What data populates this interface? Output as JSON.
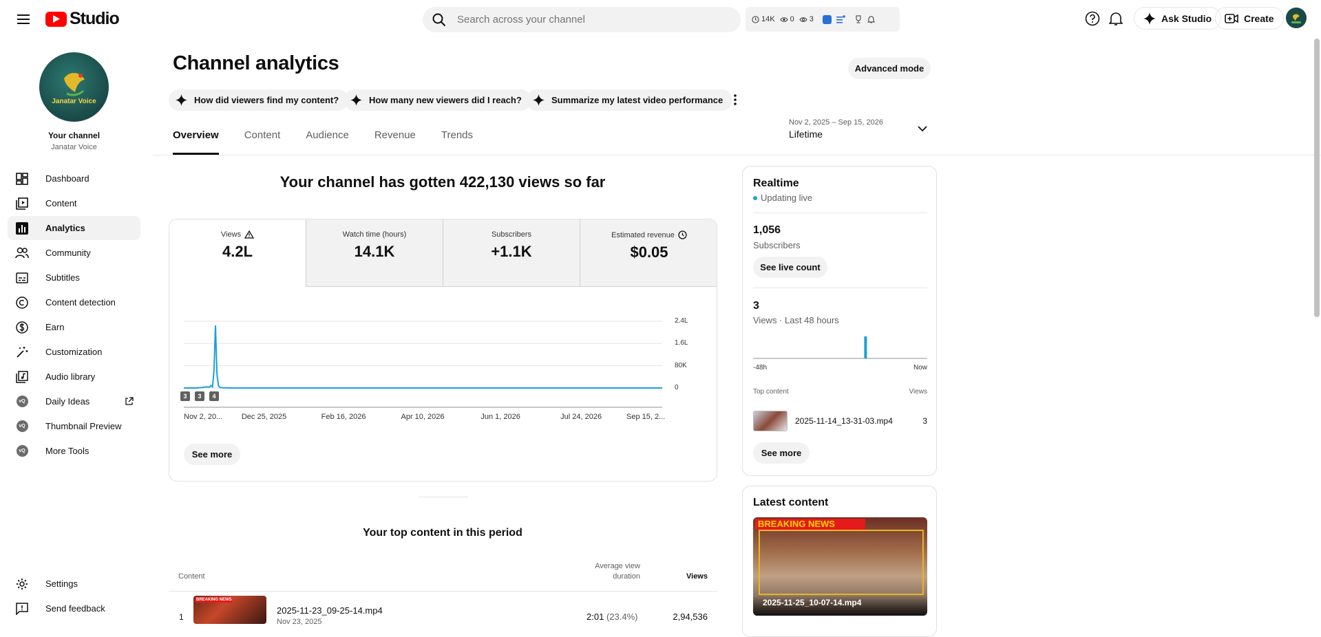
{
  "header": {
    "logo_text": "Studio",
    "search_placeholder": "Search across your channel",
    "stats": [
      {
        "icon": "clock-icon",
        "value": "14K"
      },
      {
        "icon": "eye-icon",
        "value": "0"
      },
      {
        "icon": "eye-outline-icon",
        "value": "3"
      }
    ],
    "ask_studio": "Ask Studio",
    "create": "Create"
  },
  "sidebar": {
    "channel_label": "Your channel",
    "channel_name": "Janatar Voice",
    "avatar_text": "Janatar Voice",
    "items": [
      {
        "label": "Dashboard",
        "icon": "dashboard-icon"
      },
      {
        "label": "Content",
        "icon": "content-icon"
      },
      {
        "label": "Analytics",
        "icon": "analytics-icon",
        "active": true
      },
      {
        "label": "Community",
        "icon": "community-icon"
      },
      {
        "label": "Subtitles",
        "icon": "subtitles-icon"
      },
      {
        "label": "Content detection",
        "icon": "copyright-icon"
      },
      {
        "label": "Earn",
        "icon": "dollar-icon"
      },
      {
        "label": "Customization",
        "icon": "magic-wand-icon"
      },
      {
        "label": "Audio library",
        "icon": "audio-library-icon"
      },
      {
        "label": "Daily Ideas",
        "icon": "extension-icon"
      },
      {
        "label": "Thumbnail Preview",
        "icon": "extension-icon"
      },
      {
        "label": "More Tools",
        "icon": "extension-icon"
      }
    ],
    "extension_badge": "vQ",
    "settings": "Settings",
    "feedback": "Send feedback"
  },
  "main": {
    "title": "Channel analytics",
    "advanced_mode": "Advanced mode",
    "chips": [
      "How did viewers find my content?",
      "How many new viewers did I reach?",
      "Summarize my latest video performance"
    ],
    "tabs": [
      "Overview",
      "Content",
      "Audience",
      "Revenue",
      "Trends"
    ],
    "date_range": {
      "range": "Nov 2, 2025 – Sep 15, 2026",
      "value": "Lifetime"
    },
    "headline": "Your channel has gotten 422,130 views so far",
    "metrics": [
      {
        "label": "Views",
        "value": "4.2L"
      },
      {
        "label": "Watch time (hours)",
        "value": "14.1K"
      },
      {
        "label": "Subscribers",
        "value": "+1.1K"
      },
      {
        "label": "Estimated revenue",
        "value": "$0.05"
      }
    ],
    "see_more": "See more",
    "top_content": {
      "title": "Your top content in this period",
      "col_content": "Content",
      "col_avg_1": "Average view",
      "col_avg_2": "duration",
      "col_views": "Views",
      "rows": [
        {
          "rank": "1",
          "title": "2025-11-23_09-25-14.mp4",
          "date": "Nov 23, 2025",
          "duration": "2:01",
          "pct": "(23.4%)",
          "views": "2,94,536"
        }
      ]
    }
  },
  "chart_data": {
    "type": "line",
    "x_tick_labels": [
      "Nov 2, 20...",
      "Dec 25, 2025",
      "Feb 16, 2026",
      "Apr 10, 2026",
      "Jun 1, 2026",
      "Jul 24, 2026",
      "Sep 15, 2..."
    ],
    "y_tick_labels": [
      "2.4L",
      "1.6L",
      "80K",
      "0"
    ],
    "ylim": [
      0,
      240000
    ],
    "x_range": [
      "2025-11-02",
      "2026-09-15"
    ],
    "series": [
      {
        "x": [
          "2025-11-02",
          "2025-11-10",
          "2025-11-14",
          "2025-11-17",
          "2025-11-19",
          "2025-11-20",
          "2025-11-21",
          "2025-11-22",
          "2025-11-23",
          "2025-11-24",
          "2025-11-25",
          "2025-11-26",
          "2025-11-28",
          "2025-12-02",
          "2025-12-15",
          "2026-09-15"
        ],
        "y": [
          0,
          0,
          1500,
          4000,
          3000,
          9000,
          4000,
          60000,
          225000,
          50000,
          7000,
          2000,
          500,
          0,
          0,
          0
        ],
        "color": "#1aa0d8"
      }
    ],
    "markers": [
      "3",
      "3",
      "4"
    ],
    "grid": true
  },
  "realtime": {
    "title": "Realtime",
    "live": "Updating live",
    "subs_value": "1,056",
    "subs_label": "Subscribers",
    "see_live": "See live count",
    "views_value": "3",
    "views_label": "Views · Last 48 hours",
    "axis_left": "-48h",
    "axis_right": "Now",
    "bars": {
      "hours_ago": [
        17
      ],
      "values": [
        3
      ],
      "max": 3
    },
    "top_content_label": "Top content",
    "top_views_label": "Views",
    "top_item": {
      "title": "2025-11-14_13-31-03.mp4",
      "views": "3"
    },
    "see_more": "See more"
  },
  "latest": {
    "title": "Latest content",
    "video_title": "2025-11-25_10-07-14.mp4",
    "thumb_banner": "BREAKING NEWS"
  }
}
